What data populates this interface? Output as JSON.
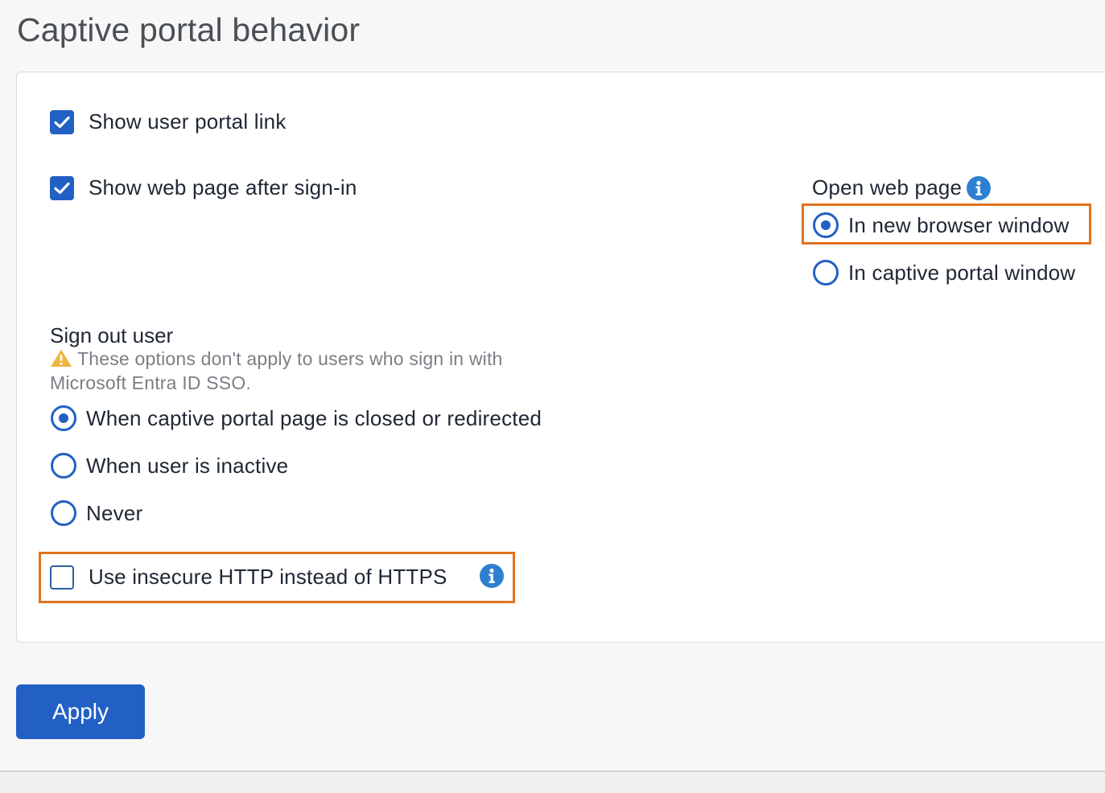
{
  "page": {
    "title": "Captive portal behavior"
  },
  "options": {
    "show_user_portal_link": {
      "label": "Show user portal link",
      "checked": true
    },
    "show_web_page": {
      "label": "Show web page after sign-in",
      "checked": true
    },
    "use_insecure_http": {
      "label": "Use insecure HTTP instead of HTTPS",
      "checked": false
    }
  },
  "open_web_page": {
    "title": "Open web page",
    "options": [
      {
        "label": "In new browser window",
        "selected": true
      },
      {
        "label": "In captive portal window",
        "selected": false
      }
    ]
  },
  "sign_out": {
    "title": "Sign out user",
    "warning": "These options don't apply to users who sign in with Microsoft Entra ID SSO.",
    "options": [
      {
        "label": "When captive portal page is closed or redirected",
        "selected": true
      },
      {
        "label": "When user is inactive",
        "selected": false
      },
      {
        "label": "Never",
        "selected": false
      }
    ]
  },
  "actions": {
    "apply_label": "Apply"
  },
  "colors": {
    "primary": "#2360c5",
    "highlight": "#e0741f",
    "warning": "#f0b341",
    "info": "#2f7fd1"
  },
  "icons": {
    "info": "info-icon",
    "warning": "warning-triangle-icon",
    "check": "checkmark-icon"
  }
}
